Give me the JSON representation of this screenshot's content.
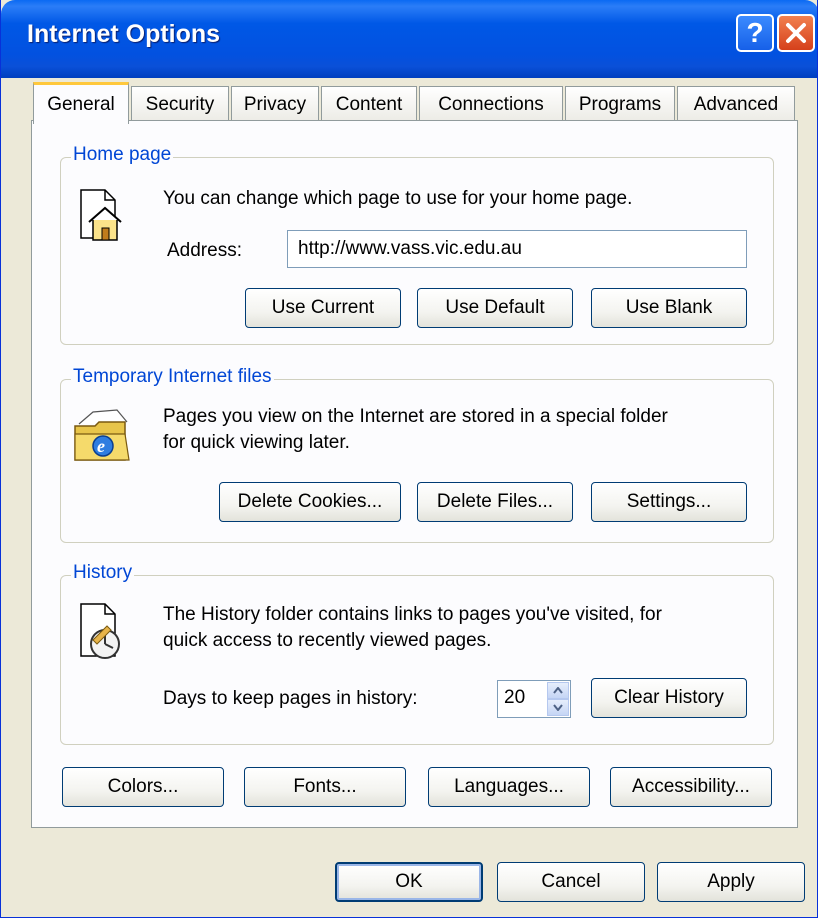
{
  "window": {
    "title": "Internet Options",
    "help_glyph": "?",
    "close_icon": "close-icon"
  },
  "tabs": [
    {
      "label": "General",
      "active": true
    },
    {
      "label": "Security"
    },
    {
      "label": "Privacy"
    },
    {
      "label": "Content"
    },
    {
      "label": "Connections"
    },
    {
      "label": "Programs"
    },
    {
      "label": "Advanced"
    }
  ],
  "home_page": {
    "label": "Home page",
    "description": "You can change which page to use for your home page.",
    "address_label": "Address:",
    "address_value": "http://www.vass.vic.edu.au",
    "buttons": {
      "use_current": "Use Current",
      "use_default": "Use Default",
      "use_blank": "Use Blank"
    },
    "icon": "home-page-icon"
  },
  "temp_files": {
    "label": "Temporary Internet files",
    "description_line1": "Pages you view on the Internet are stored in a special folder",
    "description_line2": "for quick viewing later.",
    "buttons": {
      "delete_cookies": "Delete Cookies...",
      "delete_files": "Delete Files...",
      "settings": "Settings..."
    },
    "icon": "ie-folder-icon"
  },
  "history": {
    "label": "History",
    "description_line1": "The History folder contains links to pages you've visited, for",
    "description_line2": "quick access to recently viewed pages.",
    "days_label": "Days to keep pages in history:",
    "days_value": "20",
    "clear_button": "Clear History",
    "icon": "history-icon"
  },
  "bottom_buttons": {
    "colors": "Colors...",
    "fonts": "Fonts...",
    "languages": "Languages...",
    "accessibility": "Accessibility..."
  },
  "dialog_buttons": {
    "ok": "OK",
    "cancel": "Cancel",
    "apply": "Apply"
  },
  "colors": {
    "title_bar": "#0058e6",
    "group_label": "#0046d5",
    "active_tab_accent": "#ffc83c",
    "dialog_bg": "#ece9d8"
  }
}
